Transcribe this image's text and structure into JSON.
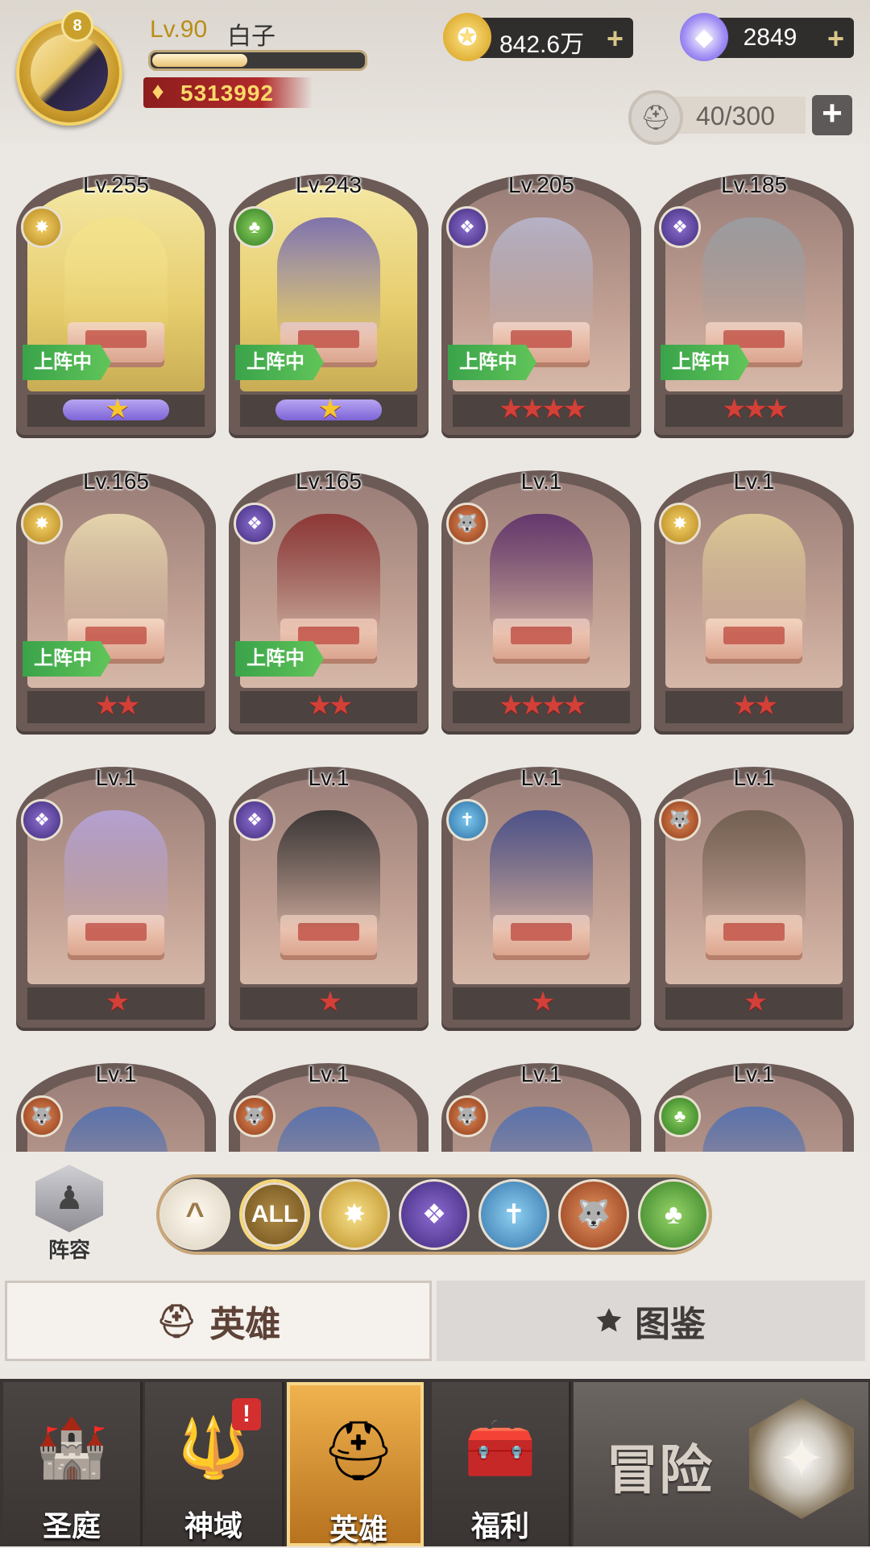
{
  "player": {
    "vip": "8",
    "level": "Lv.90",
    "name": "白子",
    "exp_fraction": 0.45,
    "power": "5313992"
  },
  "resources": {
    "gold": "842.6万",
    "gems": "2849",
    "hero_slots": "40/300"
  },
  "icons": {
    "gold": "gold-coin-icon",
    "gem": "diamond-icon",
    "helmet": "helmet-icon",
    "add": "plus-icon"
  },
  "heroes": [
    {
      "level": "Lv.255",
      "faction": "light",
      "deployed": true,
      "stars": "★",
      "star_color": "gold"
    },
    {
      "level": "Lv.243",
      "faction": "nature",
      "deployed": true,
      "stars": "★",
      "star_color": "gold"
    },
    {
      "level": "Lv.205",
      "faction": "dark",
      "deployed": true,
      "stars": "★★★★",
      "star_color": "red"
    },
    {
      "level": "Lv.185",
      "faction": "dark",
      "deployed": true,
      "stars": "★★★",
      "star_color": "red"
    },
    {
      "level": "Lv.165",
      "faction": "light",
      "deployed": true,
      "stars": "★★",
      "star_color": "red"
    },
    {
      "level": "Lv.165",
      "faction": "dark",
      "deployed": true,
      "stars": "★★",
      "star_color": "red"
    },
    {
      "level": "Lv.1",
      "faction": "beast",
      "deployed": false,
      "stars": "★★★★",
      "star_color": "red"
    },
    {
      "level": "Lv.1",
      "faction": "light",
      "deployed": false,
      "stars": "★★",
      "star_color": "red"
    },
    {
      "level": "Lv.1",
      "faction": "dark",
      "deployed": false,
      "stars": "★",
      "star_color": "red"
    },
    {
      "level": "Lv.1",
      "faction": "dark",
      "deployed": false,
      "stars": "★",
      "star_color": "red"
    },
    {
      "level": "Lv.1",
      "faction": "order",
      "deployed": false,
      "stars": "★",
      "star_color": "red"
    },
    {
      "level": "Lv.1",
      "faction": "beast",
      "deployed": false,
      "stars": "★",
      "star_color": "red"
    },
    {
      "level": "Lv.1",
      "faction": "beast",
      "deployed": false,
      "stars": "",
      "star_color": "red"
    },
    {
      "level": "Lv.1",
      "faction": "beast",
      "deployed": false,
      "stars": "",
      "star_color": "red"
    },
    {
      "level": "Lv.1",
      "faction": "beast",
      "deployed": false,
      "stars": "",
      "star_color": "red"
    },
    {
      "level": "Lv.1",
      "faction": "nature",
      "deployed": false,
      "stars": "",
      "star_color": "red"
    }
  ],
  "deploy_label": "上阵中",
  "lineup_label": "阵容",
  "filters": [
    {
      "id": "collapse",
      "label": "^",
      "icon": "chevron-up-icon"
    },
    {
      "id": "all",
      "label": "ALL",
      "icon": "all-filter-icon"
    },
    {
      "id": "light",
      "label": "",
      "icon": "light-faction-icon"
    },
    {
      "id": "dark",
      "label": "",
      "icon": "dark-faction-icon"
    },
    {
      "id": "order",
      "label": "",
      "icon": "order-faction-icon"
    },
    {
      "id": "beast",
      "label": "",
      "icon": "beast-faction-icon"
    },
    {
      "id": "nature",
      "label": "",
      "icon": "nature-faction-icon"
    }
  ],
  "tabs": {
    "heroes": "英雄",
    "codex": "图鉴"
  },
  "nav": {
    "court": "圣庭",
    "divine": "神域",
    "heroes": "英雄",
    "welfare": "福利",
    "adventure": "冒险",
    "alert": "!"
  }
}
